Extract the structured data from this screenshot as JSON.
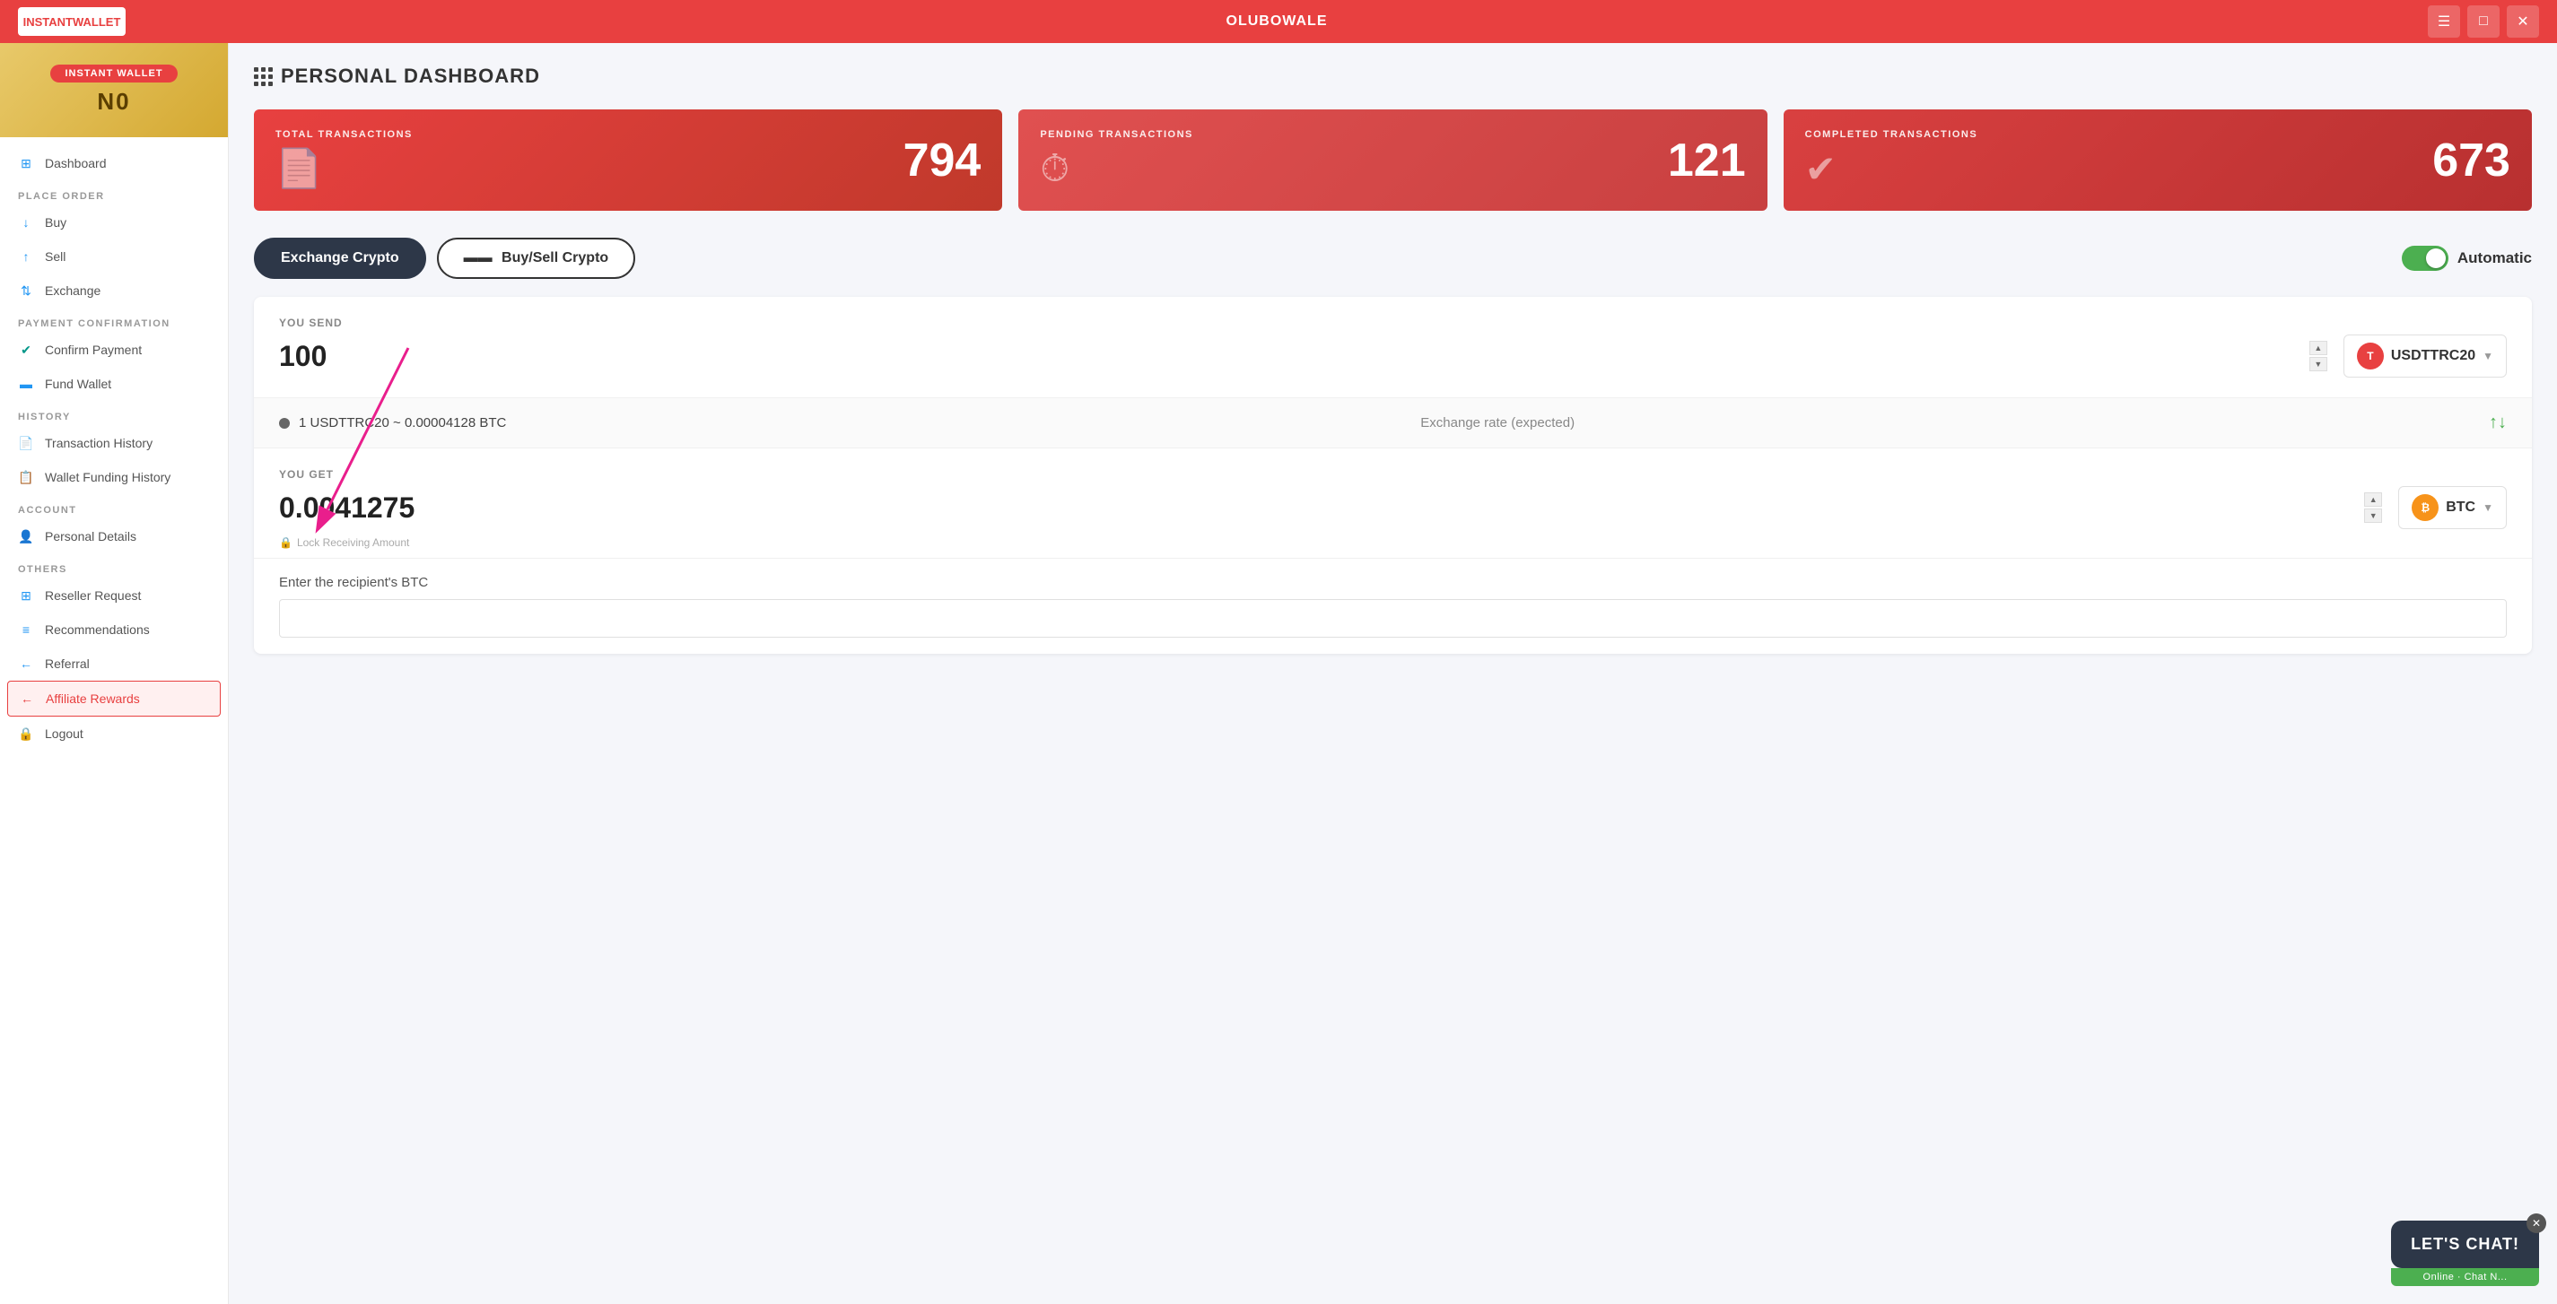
{
  "topbar": {
    "logo_text": "INSTANTWALLET",
    "username": "OLUBOWALE"
  },
  "sidebar": {
    "wallet_badge": "INSTANT WALLET",
    "wallet_no": "N0",
    "nav_sections": [
      {
        "items": [
          {
            "id": "dashboard",
            "label": "Dashboard",
            "icon": "grid"
          }
        ]
      },
      {
        "label": "PLACE ORDER",
        "items": [
          {
            "id": "buy",
            "label": "Buy",
            "icon": "arrow-down"
          },
          {
            "id": "sell",
            "label": "Sell",
            "icon": "arrow-up"
          },
          {
            "id": "exchange",
            "label": "Exchange",
            "icon": "arrows"
          }
        ]
      },
      {
        "label": "PAYMENT CONFIRMATION",
        "items": [
          {
            "id": "confirm-payment",
            "label": "Confirm Payment",
            "icon": "check"
          },
          {
            "id": "fund-wallet",
            "label": "Fund Wallet",
            "icon": "card"
          }
        ]
      },
      {
        "label": "HISTORY",
        "items": [
          {
            "id": "transaction-history",
            "label": "Transaction History",
            "icon": "doc"
          },
          {
            "id": "wallet-funding-history",
            "label": "Wallet Funding History",
            "icon": "doc2"
          }
        ]
      },
      {
        "label": "ACCOUNT",
        "items": [
          {
            "id": "personal-details",
            "label": "Personal Details",
            "icon": "user"
          }
        ]
      },
      {
        "label": "OTHERS",
        "items": [
          {
            "id": "reseller-request",
            "label": "Reseller Request",
            "icon": "grid2"
          },
          {
            "id": "recommendations",
            "label": "Recommendations",
            "icon": "list"
          },
          {
            "id": "referral",
            "label": "Referral",
            "icon": "arrow-left"
          },
          {
            "id": "affiliate-rewards",
            "label": "Affiliate Rewards",
            "icon": "arrow-left2",
            "active": true
          },
          {
            "id": "logout",
            "label": "Logout",
            "icon": "lock"
          }
        ]
      }
    ]
  },
  "main": {
    "page_title": "PERSONAL DASHBOARD",
    "stats": [
      {
        "id": "total",
        "label": "TOTAL TRANSACTIONS",
        "value": "794",
        "icon": "doc"
      },
      {
        "id": "pending",
        "label": "PENDING TRANSACTIONS",
        "value": "121",
        "icon": "clock"
      },
      {
        "id": "completed",
        "label": "COMPLETED TRANSACTIONS",
        "value": "673",
        "icon": "check"
      }
    ],
    "tabs": [
      {
        "id": "exchange-crypto",
        "label": "Exchange Crypto",
        "active": true
      },
      {
        "id": "buy-sell-crypto",
        "label": "Buy/Sell Crypto",
        "active": false
      }
    ],
    "auto_toggle": {
      "label": "Automatic",
      "enabled": true
    },
    "exchange_form": {
      "you_send_label": "YOU SEND",
      "you_send_value": "100",
      "send_currency": "USDTTRC20",
      "rate_text": "1 USDTTRC20 ~ 0.00004128 BTC",
      "rate_label": "Exchange rate (expected)",
      "you_get_label": "YOU GET",
      "you_get_value": "0.0041275",
      "get_currency": "BTC",
      "lock_hint": "Lock Receiving Amount",
      "recipient_label": "Enter the recipient's BTC",
      "recipient_placeholder": ""
    }
  },
  "chat": {
    "label": "LET'S CHAT!",
    "online_label": "Online · Chat N..."
  },
  "icons": {
    "grid": "⊞",
    "arrow_down": "↓",
    "arrow_up": "↑",
    "exchange": "⇄",
    "check": "✓",
    "card": "💳",
    "doc": "📄",
    "user": "👤",
    "lock": "🔒",
    "arrow_left": "←"
  }
}
